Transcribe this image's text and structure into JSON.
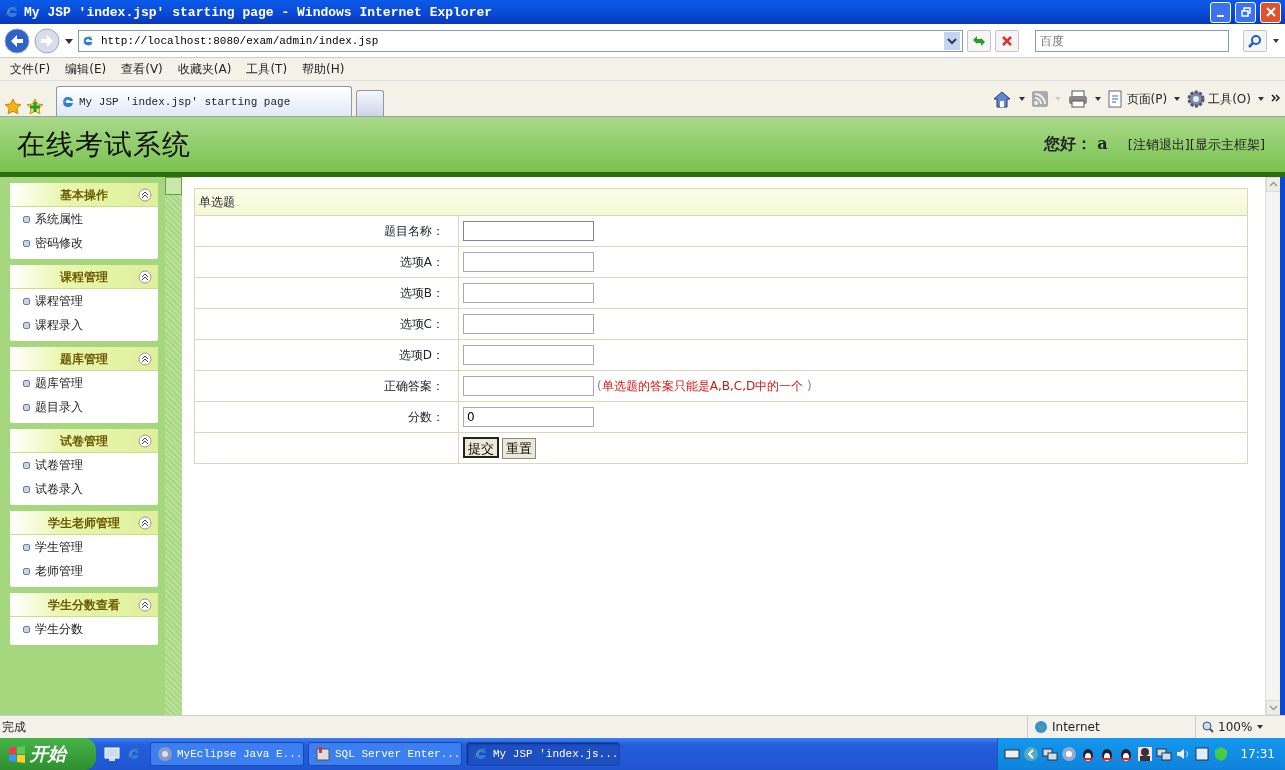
{
  "window": {
    "title": "My JSP 'index.jsp' starting page - Windows Internet Explorer"
  },
  "address_bar": {
    "url": "http://localhost:8080/exam/admin/index.jsp",
    "search_placeholder": "百度"
  },
  "menu": [
    "文件(F)",
    "编辑(E)",
    "查看(V)",
    "收藏夹(A)",
    "工具(T)",
    "帮助(H)"
  ],
  "tabs": [
    {
      "label": "My JSP 'index.jsp' starting page",
      "selected": true
    }
  ],
  "command_bar": [
    "页面(P)",
    "工具(O)"
  ],
  "header": {
    "title": "在线考试系统",
    "greeting": "您好：",
    "user": "a",
    "links": [
      "[注销退出]",
      "[显示主框架]"
    ]
  },
  "sidebar": {
    "groups": [
      {
        "title": "基本操作",
        "items": [
          "系统属性",
          "密码修改"
        ]
      },
      {
        "title": "课程管理",
        "items": [
          "课程管理",
          "课程录入"
        ]
      },
      {
        "title": "题库管理",
        "items": [
          "题库管理",
          "题目录入"
        ]
      },
      {
        "title": "试卷管理",
        "items": [
          "试卷管理",
          "试卷录入"
        ]
      },
      {
        "title": "学生老师管理",
        "items": [
          "学生管理",
          "老师管理"
        ]
      },
      {
        "title": "学生分数查看",
        "items": [
          "学生分数"
        ]
      }
    ]
  },
  "form": {
    "title": "单选题",
    "fields": [
      {
        "label": "题目名称：",
        "focused": true
      },
      {
        "label": "选项A：",
        "focused": false
      },
      {
        "label": "选项B：",
        "focused": false
      },
      {
        "label": "选项C：",
        "focused": false
      },
      {
        "label": "选项D：",
        "focused": false
      },
      {
        "label": "正确答案：",
        "focused": false,
        "hint": {
          "open": "(",
          "text": "单选题的答案只能是A,B,C,D中的一个",
          "close": ")"
        }
      },
      {
        "label": "分数：",
        "value": "0",
        "focused": false
      }
    ],
    "buttons": [
      {
        "label": "提交",
        "selected": true
      },
      {
        "label": "重置",
        "selected": false
      }
    ]
  },
  "status_bar": {
    "text": "完成",
    "zone": "Internet",
    "zoom": "100%"
  },
  "taskbar": {
    "start": "开始",
    "tasks": [
      {
        "label": "MyEclipse Java E...",
        "selected": false
      },
      {
        "label": "SQL Server Enter...",
        "selected": false
      },
      {
        "label": "My JSP 'index.js...",
        "selected": true
      }
    ],
    "clock": "17:31"
  }
}
